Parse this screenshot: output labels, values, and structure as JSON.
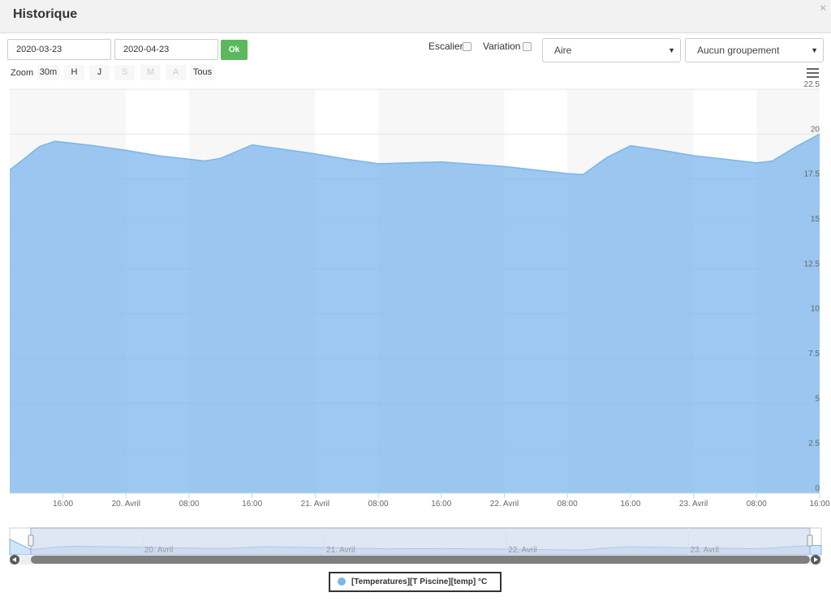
{
  "window": {
    "title": "Historique",
    "close_glyph": "×"
  },
  "filters": {
    "start_date": "2020-03-23",
    "end_date": "2020-04-23",
    "ok_label": "Ok",
    "step_label": "Escalier",
    "variation_label": "Variation",
    "chart_type_value": "Aire",
    "grouping_value": "Aucun groupement"
  },
  "zoom": {
    "label": "Zoom",
    "buttons": [
      {
        "label": "30m",
        "enabled": true
      },
      {
        "label": "H",
        "enabled": true
      },
      {
        "label": "J",
        "enabled": true
      },
      {
        "label": "S",
        "enabled": false
      },
      {
        "label": "M",
        "enabled": false
      },
      {
        "label": "A",
        "enabled": false
      },
      {
        "label": "Tous",
        "enabled": true
      }
    ]
  },
  "legend": {
    "label": "[Temperatures][T Piscine][temp] °C"
  },
  "colors": {
    "series": "#7cb5ec",
    "ok_button": "#5cb85c",
    "navigator_mask": "#c9d5ec"
  },
  "chart_data": {
    "type": "area",
    "x_range": [
      "2020-04-19 09:15",
      "2020-04-23 16:00"
    ],
    "ylim": [
      0,
      22.5
    ],
    "yticks": [
      "0",
      "2.5",
      "5",
      "7.5",
      "10",
      "12.5",
      "15",
      "17.5",
      "20",
      "22.5"
    ],
    "xtick_labels": [
      "16:00",
      "20. Avril",
      "08:00",
      "16:00",
      "21. Avril",
      "08:00",
      "16:00",
      "22. Avril",
      "08:00",
      "16:00",
      "23. Avril",
      "08:00",
      "16:00"
    ],
    "navigator_labels": [
      "20. Avril",
      "21. Avril",
      "22. Avril",
      "23. Avril"
    ],
    "series": [
      {
        "name": "[Temperatures][T Piscine][temp] °C",
        "points": [
          [
            "2020-04-19 09:15",
            18.0
          ],
          [
            "2020-04-19 11:00",
            18.6
          ],
          [
            "2020-04-19 13:00",
            19.3
          ],
          [
            "2020-04-19 15:00",
            19.6
          ],
          [
            "2020-04-19 17:00",
            19.5
          ],
          [
            "2020-04-19 20:00",
            19.35
          ],
          [
            "2020-04-20 00:00",
            19.1
          ],
          [
            "2020-04-20 04:00",
            18.8
          ],
          [
            "2020-04-20 08:00",
            18.6
          ],
          [
            "2020-04-20 10:00",
            18.5
          ],
          [
            "2020-04-20 12:00",
            18.65
          ],
          [
            "2020-04-20 16:00",
            19.4
          ],
          [
            "2020-04-20 20:00",
            19.15
          ],
          [
            "2020-04-21 00:00",
            18.9
          ],
          [
            "2020-04-21 04:00",
            18.6
          ],
          [
            "2020-04-21 08:00",
            18.35
          ],
          [
            "2020-04-21 16:00",
            18.45
          ],
          [
            "2020-04-22 00:00",
            18.2
          ],
          [
            "2020-04-22 04:00",
            18.0
          ],
          [
            "2020-04-22 08:00",
            17.8
          ],
          [
            "2020-04-22 10:00",
            17.75
          ],
          [
            "2020-04-22 13:00",
            18.7
          ],
          [
            "2020-04-22 16:00",
            19.35
          ],
          [
            "2020-04-22 20:00",
            19.1
          ],
          [
            "2020-04-23 00:00",
            18.8
          ],
          [
            "2020-04-23 04:00",
            18.6
          ],
          [
            "2020-04-23 08:00",
            18.4
          ],
          [
            "2020-04-23 10:00",
            18.5
          ],
          [
            "2020-04-23 13:00",
            19.3
          ],
          [
            "2020-04-23 16:00",
            20.0
          ]
        ]
      }
    ]
  }
}
